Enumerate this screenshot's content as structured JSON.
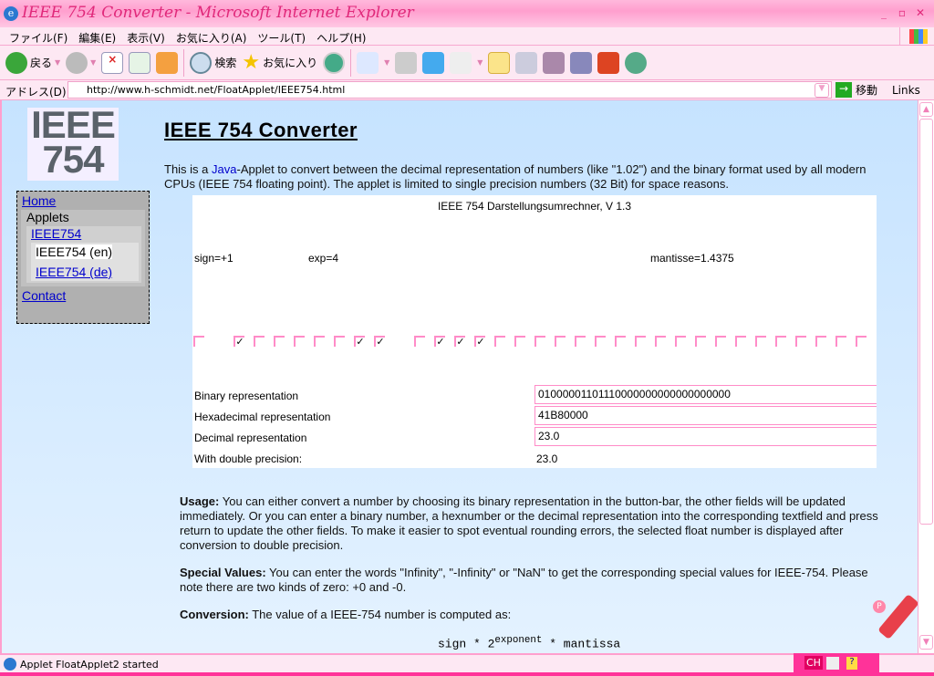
{
  "window": {
    "title": "IEEE 754 Converter - Microsoft Internet Explorer"
  },
  "menu": [
    "ファイル(F)",
    "編集(E)",
    "表示(V)",
    "お気に入り(A)",
    "ツール(T)",
    "ヘルプ(H)"
  ],
  "toolbar": {
    "back": "戻る",
    "search": "検索",
    "favorites": "お気に入り"
  },
  "address": {
    "label": "アドレス(D)",
    "url": "http://www.h-schmidt.net/FloatApplet/IEEE754.html",
    "go": "移動",
    "links": "Links"
  },
  "logo": {
    "line1": "IEEE",
    "line2": "754"
  },
  "nav": {
    "home": "Home",
    "applets": "Applets",
    "ieee754": "IEEE754",
    "en": "IEEE754 (en)",
    "de": "IEEE754 (de)",
    "contact": "Contact"
  },
  "page": {
    "title": "IEEE 754 Converter",
    "intro_pre": "This is a ",
    "intro_link": "Java",
    "intro_post": "-Applet to convert between the decimal representation of numbers (like \"1.02\") and the binary format used by all modern CPUs (IEEE 754 floating point). The applet is limited to single precision numbers (32 Bit) for space reasons.",
    "usage_label": "Usage:",
    "usage": " You can either convert a number by choosing its binary representation in the button-bar, the other fields will be updated immediately. Or you can enter a binary number, a hexnumber or the decimal representation into the corresponding textfield and press return to update the other fields. To make it easier to spot eventual rounding errors, the selected float number is displayed after conversion to double precision.",
    "special_label": "Special Values:",
    "special": " You can enter the words \"Infinity\", \"-Infinity\" or \"NaN\" to get the corresponding special values for IEEE-754. Please note there are two kinds of zero: +0 and -0.",
    "conversion_label": "Conversion:",
    "conversion": " The value of a IEEE-754 number is computed as:",
    "formula_a": "sign * 2",
    "formula_exp": "exponent",
    "formula_b": " * mantissa"
  },
  "applet": {
    "title": "IEEE 754 Darstellungsumrechner, V 1.3",
    "sign": "sign=+1",
    "exp": "exp=4",
    "mantisse": "mantisse=1.4375",
    "bits": [
      0,
      1,
      0,
      0,
      0,
      0,
      0,
      1,
      1,
      0,
      1,
      1,
      1,
      0,
      0,
      0,
      0,
      0,
      0,
      0,
      0,
      0,
      0,
      0,
      0,
      0,
      0,
      0,
      0,
      0,
      0,
      0
    ],
    "binary_label": "Binary representation",
    "binary": "01000001101110000000000000000000",
    "hex_label": "Hexadecimal representation",
    "hex": "41B80000",
    "decimal_label": "Decimal representation",
    "decimal": "23.0",
    "double_label": "With double precision:",
    "double": "23.0"
  },
  "status": {
    "text": "Applet FloatApplet2 started",
    "ime": "CH"
  }
}
